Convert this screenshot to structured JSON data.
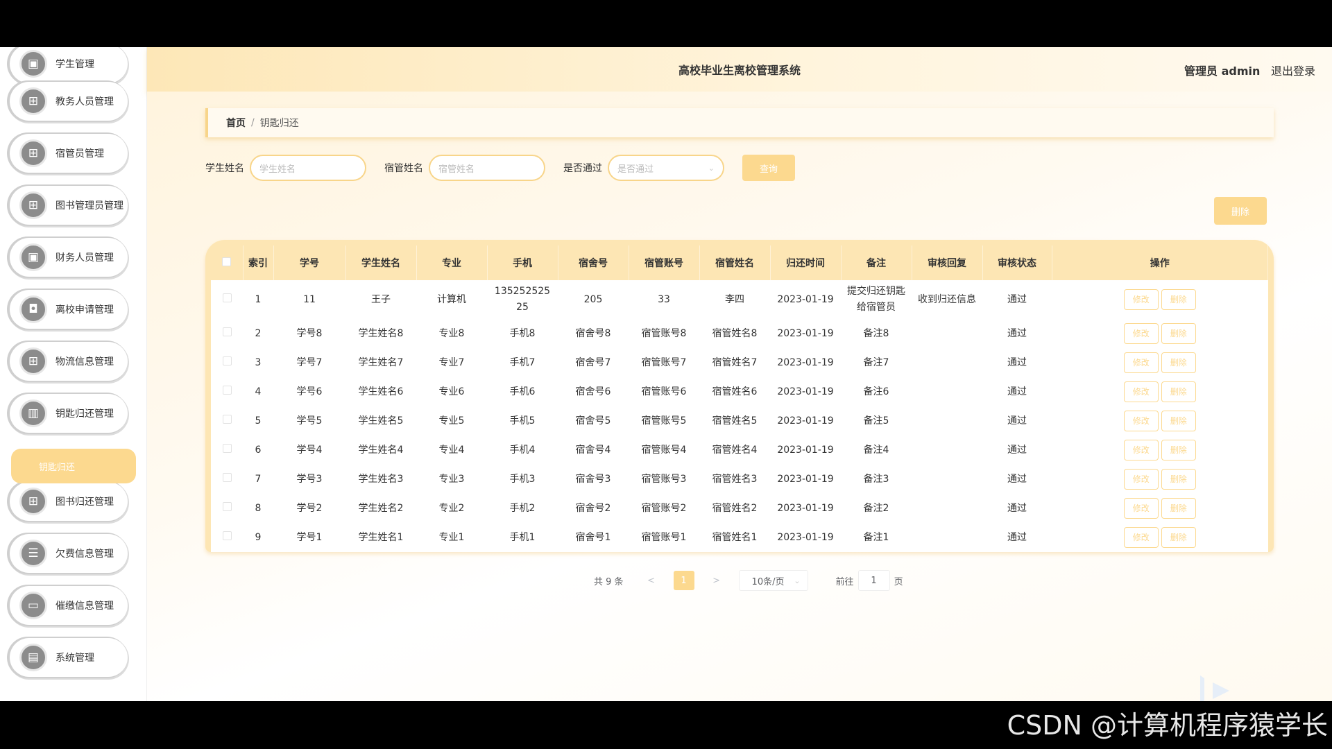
{
  "header": {
    "title": "高校毕业生离校管理系统",
    "user": "管理员 admin",
    "logout": "退出登录"
  },
  "sidebar": {
    "items": [
      {
        "label": "学生管理",
        "icon": "doc-icon",
        "glyph": "▣"
      },
      {
        "label": "教务人员管理",
        "icon": "grid-icon",
        "glyph": "⊞"
      },
      {
        "label": "宿管员管理",
        "icon": "grid-icon",
        "glyph": "⊞"
      },
      {
        "label": "图书管理员管理",
        "icon": "grid-icon",
        "glyph": "⊞"
      },
      {
        "label": "财务人员管理",
        "icon": "doc-icon",
        "glyph": "▣"
      },
      {
        "label": "离校申请管理",
        "icon": "camera-icon",
        "glyph": "◘"
      },
      {
        "label": "物流信息管理",
        "icon": "grid-icon",
        "glyph": "⊞"
      },
      {
        "label": "钥匙归还管理",
        "icon": "bar-chart-icon",
        "glyph": "▥"
      },
      {
        "label": "图书归还管理",
        "icon": "grid-icon",
        "glyph": "⊞"
      },
      {
        "label": "欠费信息管理",
        "icon": "list-icon",
        "glyph": "☰"
      },
      {
        "label": "催缴信息管理",
        "icon": "monitor-icon",
        "glyph": "▭"
      },
      {
        "label": "系统管理",
        "icon": "clipboard-icon",
        "glyph": "▤"
      }
    ],
    "active_submenu": "钥匙归还"
  },
  "breadcrumb": {
    "home": "首页",
    "separator": "/",
    "current": "钥匙归还"
  },
  "search": {
    "student_name_label": "学生姓名",
    "student_name_placeholder": "学生姓名",
    "dorm_manager_label": "宿管姓名",
    "dorm_manager_placeholder": "宿管姓名",
    "passed_label": "是否通过",
    "passed_placeholder": "是否通过",
    "query_button": "查询"
  },
  "delete_button": "删除",
  "table": {
    "columns": [
      "索引",
      "学号",
      "学生姓名",
      "专业",
      "手机",
      "宿舍号",
      "宿管账号",
      "宿管姓名",
      "归还时间",
      "备注",
      "审核回复",
      "审核状态",
      "操作"
    ],
    "rows": [
      {
        "index": "1",
        "student_no": "11",
        "name": "王子",
        "major": "计算机",
        "phone": "13525252525",
        "dorm": "205",
        "manager_account": "33",
        "manager_name": "李四",
        "return_time": "2023-01-19",
        "note": "提交归还钥匙给宿管员",
        "reply": "收到归还信息",
        "status": "通过"
      },
      {
        "index": "2",
        "student_no": "学号8",
        "name": "学生姓名8",
        "major": "专业8",
        "phone": "手机8",
        "dorm": "宿舍号8",
        "manager_account": "宿管账号8",
        "manager_name": "宿管姓名8",
        "return_time": "2023-01-19",
        "note": "备注8",
        "reply": "",
        "status": "通过"
      },
      {
        "index": "3",
        "student_no": "学号7",
        "name": "学生姓名7",
        "major": "专业7",
        "phone": "手机7",
        "dorm": "宿舍号7",
        "manager_account": "宿管账号7",
        "manager_name": "宿管姓名7",
        "return_time": "2023-01-19",
        "note": "备注7",
        "reply": "",
        "status": "通过"
      },
      {
        "index": "4",
        "student_no": "学号6",
        "name": "学生姓名6",
        "major": "专业6",
        "phone": "手机6",
        "dorm": "宿舍号6",
        "manager_account": "宿管账号6",
        "manager_name": "宿管姓名6",
        "return_time": "2023-01-19",
        "note": "备注6",
        "reply": "",
        "status": "通过"
      },
      {
        "index": "5",
        "student_no": "学号5",
        "name": "学生姓名5",
        "major": "专业5",
        "phone": "手机5",
        "dorm": "宿舍号5",
        "manager_account": "宿管账号5",
        "manager_name": "宿管姓名5",
        "return_time": "2023-01-19",
        "note": "备注5",
        "reply": "",
        "status": "通过"
      },
      {
        "index": "6",
        "student_no": "学号4",
        "name": "学生姓名4",
        "major": "专业4",
        "phone": "手机4",
        "dorm": "宿舍号4",
        "manager_account": "宿管账号4",
        "manager_name": "宿管姓名4",
        "return_time": "2023-01-19",
        "note": "备注4",
        "reply": "",
        "status": "通过"
      },
      {
        "index": "7",
        "student_no": "学号3",
        "name": "学生姓名3",
        "major": "专业3",
        "phone": "手机3",
        "dorm": "宿舍号3",
        "manager_account": "宿管账号3",
        "manager_name": "宿管姓名3",
        "return_time": "2023-01-19",
        "note": "备注3",
        "reply": "",
        "status": "通过"
      },
      {
        "index": "8",
        "student_no": "学号2",
        "name": "学生姓名2",
        "major": "专业2",
        "phone": "手机2",
        "dorm": "宿舍号2",
        "manager_account": "宿管账号2",
        "manager_name": "宿管姓名2",
        "return_time": "2023-01-19",
        "note": "备注2",
        "reply": "",
        "status": "通过"
      },
      {
        "index": "9",
        "student_no": "学号1",
        "name": "学生姓名1",
        "major": "专业1",
        "phone": "手机1",
        "dorm": "宿舍号1",
        "manager_account": "宿管账号1",
        "manager_name": "宿管姓名1",
        "return_time": "2023-01-19",
        "note": "备注1",
        "reply": "",
        "status": "通过"
      }
    ],
    "edit_label": "修改",
    "delete_label": "删除"
  },
  "pagination": {
    "total": "共 9 条",
    "prev": "<",
    "page": "1",
    "next": ">",
    "page_size": "10条/页",
    "goto_label": "前往",
    "goto_value": "1",
    "goto_suffix": "页"
  },
  "watermark": "CSDN @计算机程序猿学长",
  "colors": {
    "accent": "#fcd98f",
    "header_bg": "#fde7b7",
    "table_header": "#fde6b4"
  }
}
